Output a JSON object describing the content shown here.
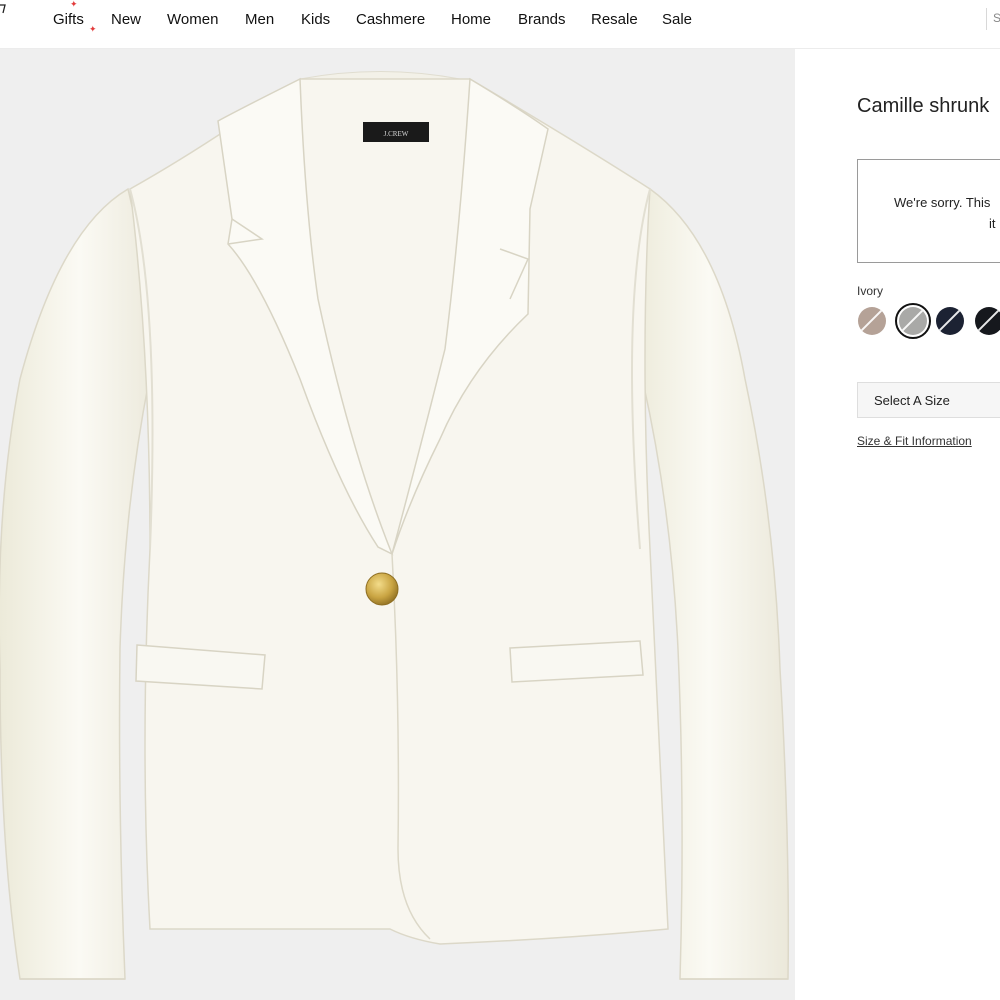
{
  "nav": {
    "items": [
      "Gifts",
      "New",
      "Women",
      "Men",
      "Kids",
      "Cashmere",
      "Home",
      "Brands",
      "Resale",
      "Sale"
    ],
    "search_placeholder": "S"
  },
  "product": {
    "title": "Camille shrunk",
    "label_text": "J.CREW",
    "unavailable_line1": "We're sorry. This",
    "unavailable_line2": "it",
    "color_label": "Ivory",
    "swatches": [
      {
        "name": "beige-swatch",
        "color": "#b5a297"
      },
      {
        "name": "grey-swatch",
        "color": "#a9a9a7",
        "selected": true
      },
      {
        "name": "navy-swatch",
        "color": "#1c2233"
      },
      {
        "name": "black-swatch",
        "color": "#16181d"
      }
    ],
    "size_select_label": "Select A Size",
    "fit_link": "Size & Fit Information"
  },
  "colors": {
    "image_background": "#efefef",
    "jacket": "#f7f5ef",
    "button_gold": "#c9a442",
    "accent_red": "#e23b3b"
  }
}
